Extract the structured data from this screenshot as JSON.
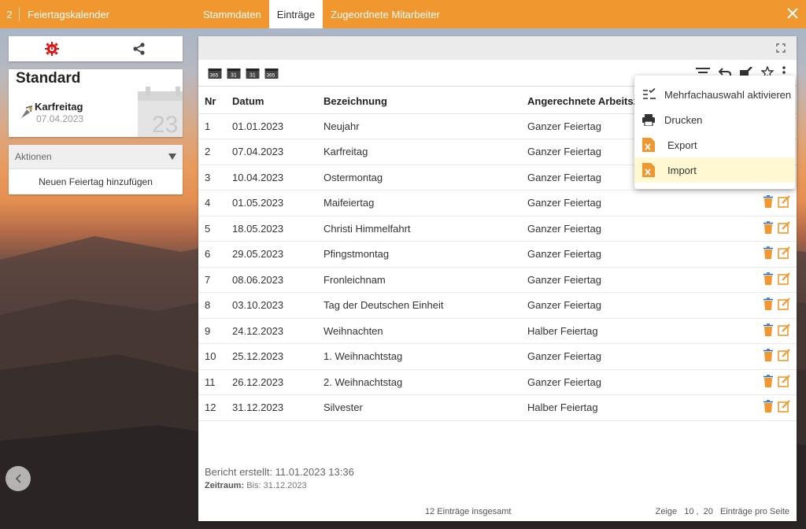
{
  "topbar": {
    "number": "2",
    "title": "Feiertagskalender",
    "tabs": [
      {
        "label": "Stammdaten",
        "active": false
      },
      {
        "label": "Einträge",
        "active": true
      },
      {
        "label": "Zugeordnete Mitarbeiter",
        "active": false
      }
    ],
    "close_icon": "close-icon"
  },
  "left": {
    "card": {
      "title": "Standard",
      "holiday_name": "Karfreitag",
      "holiday_date": "07.04.2023",
      "calendar_day": "23"
    },
    "actions": {
      "header": "Aktionen",
      "items": [
        "Neuen Feiertag hinzufügen"
      ]
    }
  },
  "table": {
    "headers": [
      "Nr",
      "Datum",
      "Bezeichnung",
      "Angerechnete Arbeitsze"
    ],
    "rows": [
      {
        "nr": "1",
        "datum": "01.01.2023",
        "bez": "Neujahr",
        "art": "Ganzer Feiertag"
      },
      {
        "nr": "2",
        "datum": "07.04.2023",
        "bez": "Karfreitag",
        "art": "Ganzer Feiertag"
      },
      {
        "nr": "3",
        "datum": "10.04.2023",
        "bez": "Ostermontag",
        "art": "Ganzer Feiertag"
      },
      {
        "nr": "4",
        "datum": "01.05.2023",
        "bez": "Maifeiertag",
        "art": "Ganzer Feiertag"
      },
      {
        "nr": "5",
        "datum": "18.05.2023",
        "bez": "Christi Himmelfahrt",
        "art": "Ganzer Feiertag"
      },
      {
        "nr": "6",
        "datum": "29.05.2023",
        "bez": "Pfingstmontag",
        "art": "Ganzer Feiertag"
      },
      {
        "nr": "7",
        "datum": "08.06.2023",
        "bez": "Fronleichnam",
        "art": "Ganzer Feiertag"
      },
      {
        "nr": "8",
        "datum": "03.10.2023",
        "bez": "Tag der Deutschen Einheit",
        "art": "Ganzer Feiertag"
      },
      {
        "nr": "9",
        "datum": "24.12.2023",
        "bez": "Weihnachten",
        "art": "Halber Feiertag"
      },
      {
        "nr": "10",
        "datum": "25.12.2023",
        "bez": "1. Weihnachtstag",
        "art": "Ganzer Feiertag"
      },
      {
        "nr": "11",
        "datum": "26.12.2023",
        "bez": "2. Weihnachtstag",
        "art": "Ganzer Feiertag"
      },
      {
        "nr": "12",
        "datum": "31.12.2023",
        "bez": "Silvester",
        "art": "Halber Feiertag"
      }
    ]
  },
  "toolbar": {
    "calendar_icons": [
      "365",
      "31",
      "31",
      "365"
    ]
  },
  "menu": {
    "items": [
      {
        "label": "Mehrfachauswahl aktivieren",
        "icon": "multi-select-icon"
      },
      {
        "label": "Drucken",
        "icon": "printer-icon"
      },
      {
        "label": "Export",
        "icon": "excel-export-icon"
      },
      {
        "label": "Import",
        "icon": "excel-import-icon"
      }
    ]
  },
  "report": {
    "created": "Bericht erstellt: 11.01.2023 13:36",
    "period_label": "Zeitraum:",
    "period_value": "Bis: 31.12.2023"
  },
  "footer": {
    "total": "12 Einträge insgesamt",
    "show": "Zeige",
    "opt1": "10",
    "comma": ",",
    "opt2": "20",
    "per_page": "Einträge pro Seite"
  },
  "colors": {
    "accent": "#f0972f",
    "menu_highlight": "#fff8d1"
  }
}
